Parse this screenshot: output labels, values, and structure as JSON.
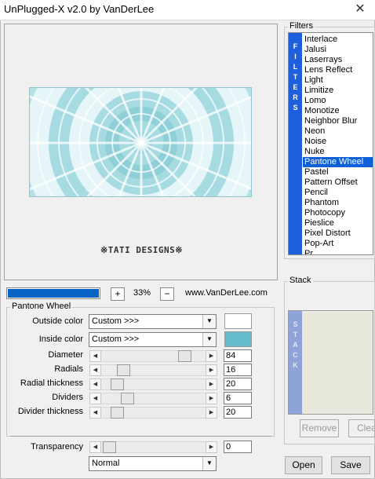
{
  "window": {
    "title": "UnPlugged-X v2.0 by VanDerLee",
    "close_glyph": "✕"
  },
  "preview": {
    "watermark": "※TATI DESIGNS※"
  },
  "toolbar": {
    "progress": 1.0,
    "zoom_in": "+",
    "zoom": "33%",
    "zoom_out": "−",
    "url": "www.VanDerLee.com"
  },
  "params": {
    "group_title": "Pantone Wheel",
    "outside_color": {
      "label": "Outside color",
      "value": "Custom >>>",
      "swatch": "#ffffff"
    },
    "inside_color": {
      "label": "Inside color",
      "value": "Custom >>>",
      "swatch": "#64bccc"
    },
    "sliders": [
      {
        "label": "Diameter",
        "value": "84",
        "fraction": 0.84
      },
      {
        "label": "Radials",
        "value": "16",
        "fraction": 0.16
      },
      {
        "label": "Radial thickness",
        "value": "20",
        "fraction": 0.09
      },
      {
        "label": "Dividers",
        "value": "6",
        "fraction": 0.2
      },
      {
        "label": "Divider thickness",
        "value": "20",
        "fraction": 0.09
      }
    ],
    "transparency": {
      "label": "Transparency",
      "value": "0",
      "fraction": 0.0
    },
    "blend_mode": "Normal"
  },
  "filters": {
    "group_title": "Filters",
    "strip_letters": [
      "F",
      "I",
      "L",
      "T",
      "E",
      "R",
      "S"
    ],
    "items": [
      "Interlace",
      "Jalusi",
      "Laserrays",
      "Lens Reflect",
      "Light",
      "Limitize",
      "Lomo",
      "Monotize",
      "Neighbor Blur",
      "Neon",
      "Noise",
      "Nuke",
      "Pantone Wheel",
      "Pastel",
      "Pattern Offset",
      "Pencil",
      "Phantom",
      "Photocopy",
      "Pieslice",
      "Pixel Distort",
      "Pop-Art",
      "Pr..."
    ],
    "selected": "Pantone Wheel"
  },
  "stack": {
    "group_title": "Stack",
    "strip_letters": [
      "S",
      "T",
      "A",
      "C",
      "K"
    ],
    "remove_label": "Remove",
    "clear_label": "Clea"
  },
  "footer": {
    "open_label": "Open",
    "save_label": "Save"
  },
  "colors": {
    "accent": "#1d5fdc",
    "selection": "#0f5fd8",
    "preview_bg": "#b3e1e6",
    "wheel_light": "#e6f6f8",
    "wheel_mid": "#a7dbe2",
    "wheel_dark": "#8fd0d8"
  }
}
